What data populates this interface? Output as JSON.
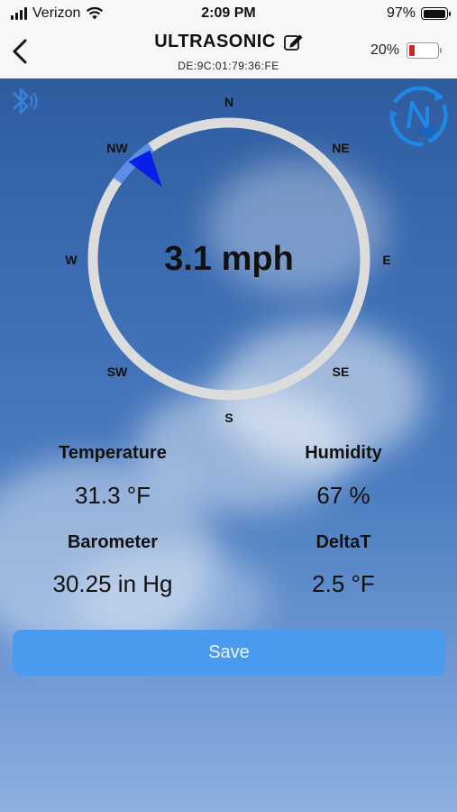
{
  "status_bar": {
    "carrier": "Verizon",
    "time": "2:09 PM",
    "battery": "97%",
    "battery_level": 0.97
  },
  "nav": {
    "title": "ULTRASONIC",
    "device_id": "DE:9C:01:79:36:FE",
    "device_battery": "20%",
    "device_battery_level": 0.2,
    "icons": [
      "chevron-left-icon",
      "edit-icon"
    ]
  },
  "wind": {
    "speed": "3.1 mph",
    "direction_deg": 315,
    "directions": {
      "n": "N",
      "ne": "NE",
      "e": "E",
      "se": "SE",
      "s": "S",
      "sw": "SW",
      "w": "W",
      "nw": "NW"
    }
  },
  "metrics": {
    "temperature": {
      "label": "Temperature",
      "value": "31.3 °F"
    },
    "humidity": {
      "label": "Humidity",
      "value": "67 %"
    },
    "barometer": {
      "label": "Barometer",
      "value": "30.25 in Hg"
    },
    "deltat": {
      "label": "DeltaT",
      "value": "2.5 °F"
    }
  },
  "save_label": "Save",
  "colors": {
    "accent": "#4a9bf0",
    "arrow": "#0a1ee6",
    "battery_low": "#c62828",
    "ring": "#dcdcdc",
    "bluetooth": "#3b7fd8"
  },
  "icons": [
    "bluetooth-icon",
    "compass-calibrate-icon",
    "wind-direction-arrow-icon"
  ]
}
